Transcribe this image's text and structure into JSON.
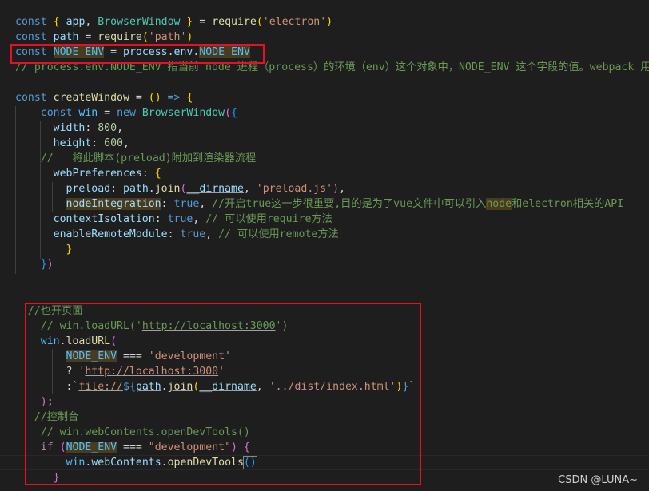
{
  "editor": {
    "language": "javascript",
    "theme_colors": {
      "background": "#1e1e1e",
      "keyword": "#569cd6",
      "string": "#ce9178",
      "comment": "#6a9955",
      "highlight_box": "#e81123"
    },
    "lines": {
      "l1_comment": "// process.env.NODE_ENV 指当前 node 进程（process）的环境（env）这个对象中，NODE_ENV 这个字段的值。webpack 用",
      "l9_comment": "//   将此脚本(preload)附加到渲染器流程",
      "l12_comment": " //开启true这一步很重要,目的是为了vue文件中可以引入",
      "l12_comment_hl": "node",
      "l12_comment_tail": "和electron相关的API",
      "l13_comment": " // 可以使用require方法",
      "l14_comment": " // 可以使用remote方法",
      "l18_comment": "//也开页面",
      "l19_comment": "// win.loadURL('",
      "l19_url": "http://localhost:3000",
      "l19_tail": "')",
      "l26_comment": "//控制台",
      "l27_comment": "// win.webContents.openDevTools()"
    }
  },
  "watermark": "CSDN @LUNA~"
}
